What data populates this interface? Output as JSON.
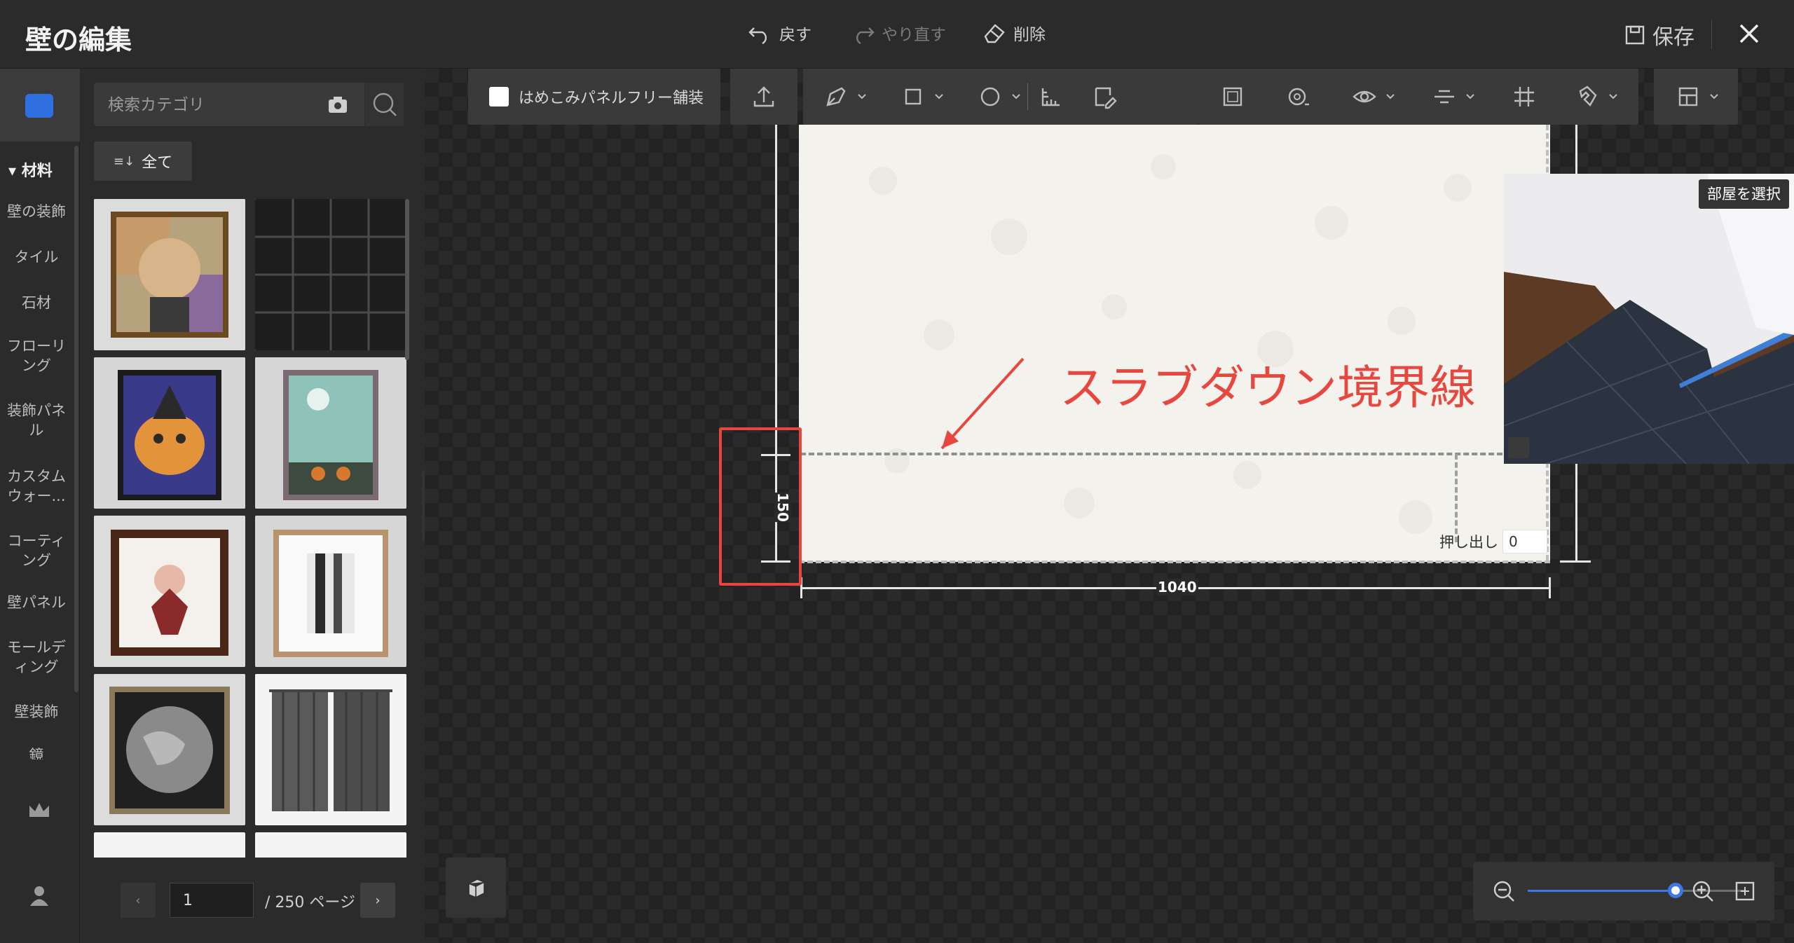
{
  "app": {
    "title": "壁の編集",
    "undo_label": "戻す",
    "redo_label": "やり直す",
    "delete_label": "削除",
    "save_label": "保存"
  },
  "catnav": {
    "section_label": "材料",
    "items": [
      "壁の装飾",
      "タイル",
      "石材",
      "フローリング",
      "装飾パネル",
      "カスタムウォー...",
      "コーティング",
      "壁パネル",
      "モールディング",
      "壁装飾",
      "鏡"
    ]
  },
  "panel": {
    "search_placeholder": "検索カテゴリ",
    "filter_label": "全て",
    "page_current": "1",
    "page_total_label": "/ 250 ページ"
  },
  "toolbar": {
    "seamless_label": "はめこみパネルフリー舗装"
  },
  "canvas": {
    "annotation_text": "スラブダウン境界線",
    "dim_height": "150",
    "dim_width": "1040",
    "extrude_label": "押し出し",
    "extrude_value": "0",
    "room_select_label": "部屋を選択"
  },
  "colors": {
    "accent": "#3b78ea",
    "annotation": "#e8473f"
  }
}
